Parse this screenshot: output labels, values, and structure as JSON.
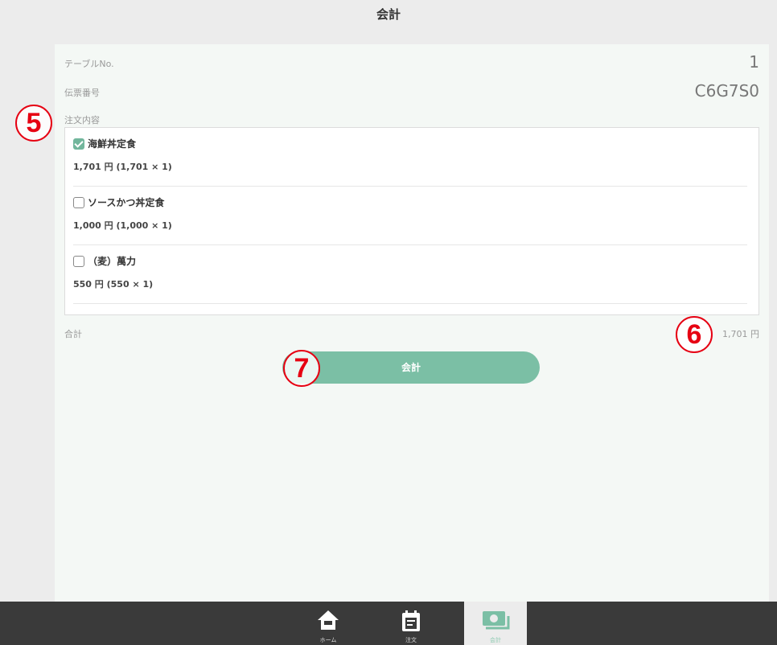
{
  "header": {
    "title": "会計"
  },
  "info": {
    "table_label": "テーブルNo.",
    "table_value": "1",
    "slip_label": "伝票番号",
    "slip_value": "C6G7S0",
    "order_label": "注文内容"
  },
  "order_items": [
    {
      "name": "海鮮丼定食",
      "price": "1,701 円 (1,701 × 1)",
      "checked": true
    },
    {
      "name": "ソースかつ丼定食",
      "price": "1,000 円 (1,000 × 1)",
      "checked": false
    },
    {
      "name": "（麦）萬力",
      "price": "550 円 (550 × 1)",
      "checked": false
    }
  ],
  "total": {
    "label": "合計",
    "value": "1,701 円"
  },
  "pay_button": {
    "label": "会計"
  },
  "markers": {
    "m5": "5",
    "m6": "6",
    "m7": "7"
  },
  "nav": {
    "items": [
      {
        "label": "ホーム",
        "icon": "home-icon"
      },
      {
        "label": "注文",
        "icon": "order-list-icon"
      },
      {
        "label": "会計",
        "icon": "cash-icon",
        "active": true
      }
    ]
  },
  "colors": {
    "accent": "#7bbfa5",
    "marker": "#e60012",
    "nav_bg": "#3a3a3a"
  }
}
